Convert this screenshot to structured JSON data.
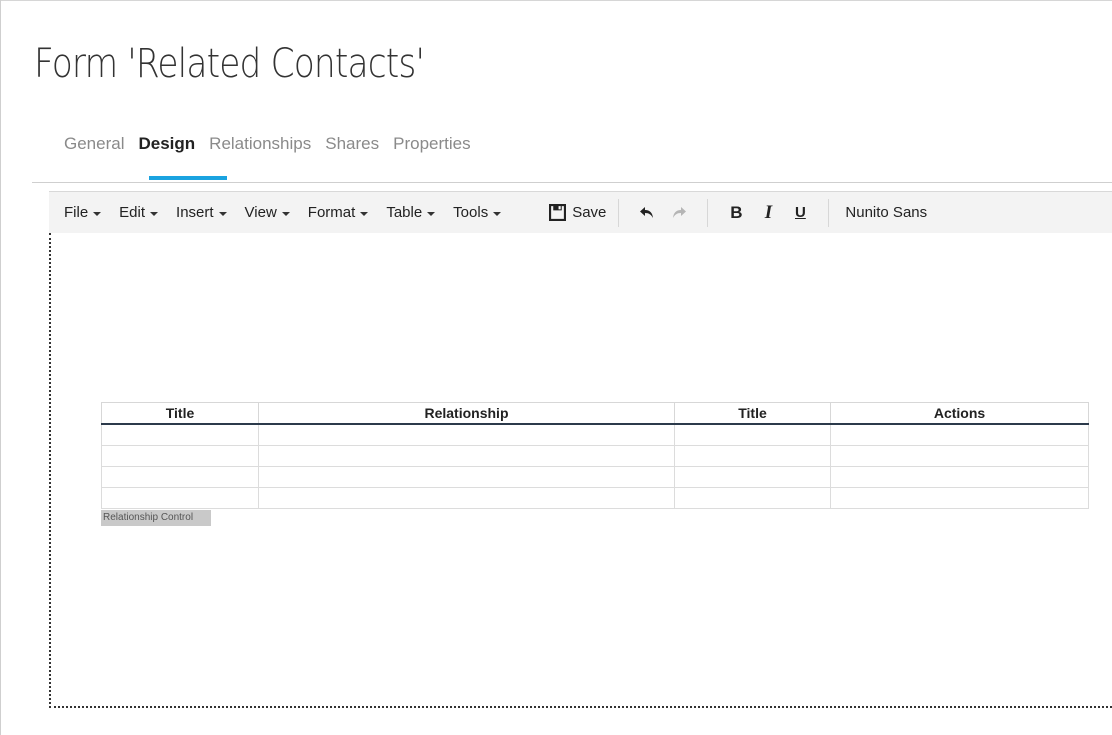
{
  "page": {
    "title": "Form 'Related Contacts'"
  },
  "tabs": [
    {
      "label": "General",
      "active": false
    },
    {
      "label": "Design",
      "active": true
    },
    {
      "label": "Relationships",
      "active": false
    },
    {
      "label": "Shares",
      "active": false
    },
    {
      "label": "Properties",
      "active": false
    }
  ],
  "toolbar": {
    "menus": [
      "File",
      "Edit",
      "Insert",
      "View",
      "Format",
      "Table",
      "Tools"
    ],
    "save_label": "Save",
    "font_name": "Nunito Sans",
    "icons": [
      "save-icon",
      "undo-icon",
      "redo-icon",
      "bold-icon",
      "italic-icon",
      "underline-icon"
    ]
  },
  "relationship_table": {
    "columns": [
      "Title",
      "Relationship",
      "Title",
      "Actions"
    ],
    "empty_rows": 4,
    "caption": "Relationship Control"
  },
  "colors": {
    "accent": "#1aa3e0",
    "header_rule": "#2c3a4b"
  }
}
